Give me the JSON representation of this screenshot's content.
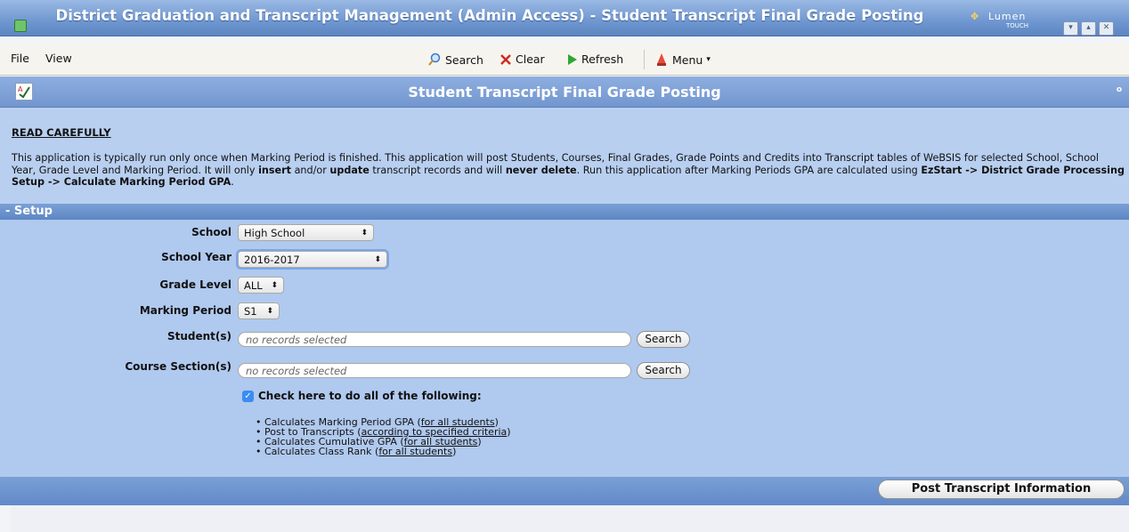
{
  "window": {
    "title": "District Graduation and Transcript Management (Admin Access) - Student Transcript Final Grade Posting",
    "brand": "Lumen",
    "brand_sub": "TOUCH"
  },
  "menu": {
    "file": "File",
    "view": "View"
  },
  "toolbar": {
    "search": "Search",
    "clear": "Clear",
    "refresh": "Refresh",
    "menu": "Menu"
  },
  "page": {
    "title": "Student Transcript Final Grade Posting",
    "corner": "o"
  },
  "notice": {
    "heading": "READ CAREFULLY",
    "p1": "This application is typically run only once when Marking Period is finished. This application will post Students, Courses, Final Grades, Grade Points and Credits into Transcript tables of WeBSIS for selected School, School Year, Grade Level and Marking Period. It will only ",
    "b1": "insert",
    "p2": " and/or ",
    "b2": "update",
    "p3": " transcript records and will ",
    "b3": "never delete",
    "p4": ". Run this application after Marking Periods GPA are calculated using ",
    "b4": "EzStart -> District Grade Processing Setup -> Calculate Marking Period GPA",
    "p5": "."
  },
  "setup": {
    "header": "- Setup",
    "school": {
      "label": "School",
      "value": "High School"
    },
    "school_year": {
      "label": "School Year",
      "value": "2016-2017"
    },
    "grade_level": {
      "label": "Grade Level",
      "value": "ALL"
    },
    "marking_period": {
      "label": "Marking Period",
      "value": "S1"
    },
    "students": {
      "label": "Student(s)",
      "placeholder": "no records selected",
      "button": "Search"
    },
    "course_sections": {
      "label": "Course Section(s)",
      "placeholder": "no records selected",
      "button": "Search"
    },
    "check_all": {
      "checked": true,
      "label": "Check here to do all of the following:"
    },
    "bullets": [
      {
        "text": "Calculates Marking Period GPA (",
        "link": "for all students",
        "end": ")"
      },
      {
        "text": "Post to Transcripts (",
        "link": "according to specified criteria",
        "end": ")"
      },
      {
        "text": "Calculates Cumulative GPA (",
        "link": "for all students",
        "end": ")"
      },
      {
        "text": "Calculates Class Rank (",
        "link": "for all students",
        "end": ")"
      }
    ]
  },
  "footer": {
    "post_button": "Post Transcript Information"
  },
  "colors": {
    "accent": "#6f97d0",
    "panel": "#b0c9ee",
    "checkbox": "#3b8cf2"
  }
}
